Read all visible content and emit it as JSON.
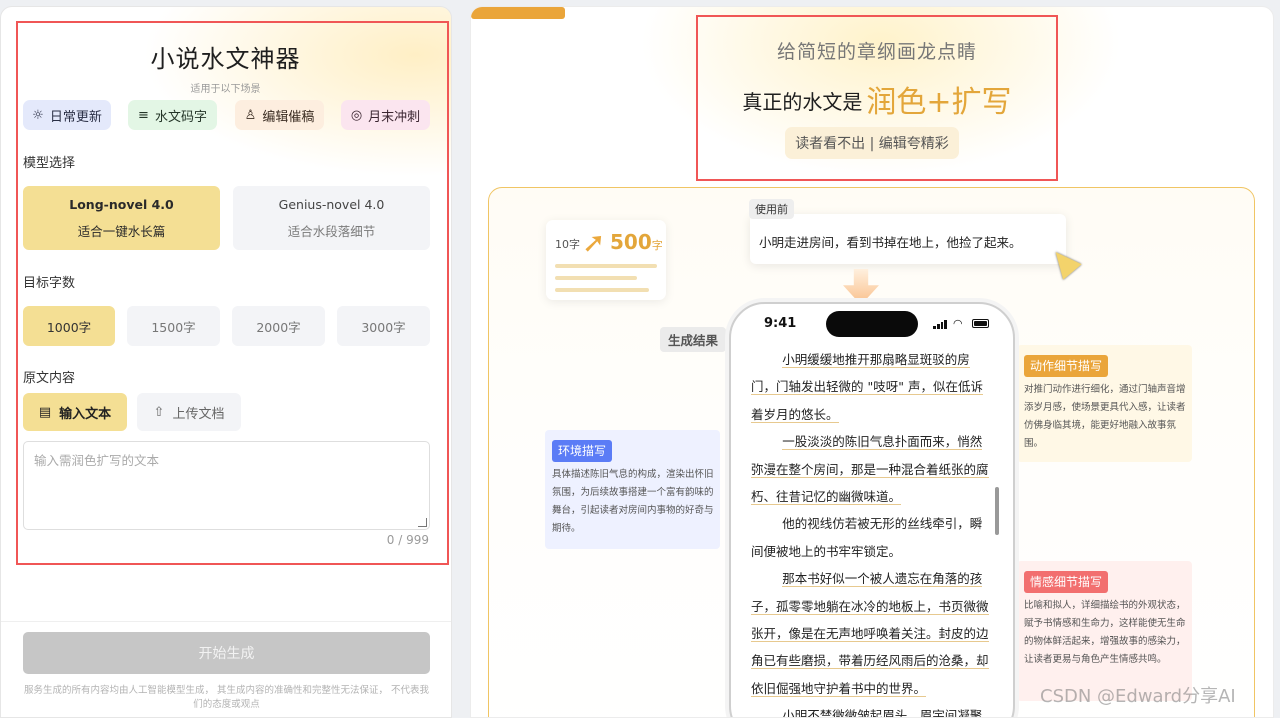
{
  "left": {
    "title": "小说水文神器",
    "subtitle": "适用于以下场景",
    "scenes": [
      {
        "icon": "☼",
        "label": "日常更新"
      },
      {
        "icon": "≡",
        "label": "水文码字"
      },
      {
        "icon": "♙",
        "label": "编辑催稿"
      },
      {
        "icon": "◎",
        "label": "月末冲刺"
      }
    ],
    "model_label": "模型选择",
    "models": [
      {
        "name": "Long-novel 4.0",
        "desc": "适合一键水长篇",
        "selected": true
      },
      {
        "name": "Genius-novel 4.0",
        "desc": "适合水段落细节",
        "selected": false
      }
    ],
    "count_label": "目标字数",
    "counts": [
      "1000字",
      "1500字",
      "2000字",
      "3000字"
    ],
    "selected_count": "1000字",
    "source_label": "原文内容",
    "source_modes": [
      {
        "icon": "▤",
        "label": "输入文本"
      },
      {
        "icon": "⇧",
        "label": "上传文档"
      }
    ],
    "textarea_placeholder": "输入需润色扩写的文本",
    "char_counter": "0 / 999",
    "generate_label": "开始生成",
    "disclaimer": "服务生成的所有内容均由人工智能模型生成， 其生成内容的准确性和完整性无法保证， 不代表我们的态度或观点"
  },
  "right": {
    "hero": {
      "line1": "给简短的章纲画龙点睛",
      "line2_prefix": "真正的水文是",
      "line2_accent": "润色+扩写",
      "pill": "读者看不出 | 编辑夸精彩"
    },
    "stat": {
      "from": "10字",
      "to_num": "500",
      "to_unit": "字"
    },
    "before": {
      "tag": "使用前",
      "text": "小明走进房间，看到书掉在地上，他捡了起来。"
    },
    "result_tag": "生成结果",
    "phone": {
      "time": "9:41",
      "paragraphs": [
        "小明缓缓地推开那扇略显斑驳的房门，门轴发出轻微的 \"吱呀\" 声，似在低诉着岁月的悠长。",
        "一股淡淡的陈旧气息扑面而来，悄然弥漫在整个房间，那是一种混合着纸张的腐朽、往昔记忆的幽微味道。",
        "他的视线仿若被无形的丝线牵引，瞬间便被地上的书牢牢锁定。",
        "那本书好似一个被人遗忘在角落的孩子，孤零零地躺在冰冷的地板上，书页微微张开，像是在无声地呼唤着关注。封皮的边角已有些磨损，带着历经风雨后的沧桑，却依旧倔强地守护着书中的世界。",
        "小明不禁微微皱起眉头，眉宇间凝聚"
      ]
    },
    "annotations": {
      "env": {
        "tag": "环境描写",
        "text": "具体描述陈旧气息的构成，渲染出怀旧氛围，为后续故事搭建一个富有韵味的舞台，引起读者对房间内事物的好奇与期待。"
      },
      "action": {
        "tag": "动作细节描写",
        "text": "对推门动作进行细化，通过门轴声音增添岁月感，使场景更具代入感，让读者仿佛身临其境，能更好地融入故事氛围。"
      },
      "emotion": {
        "tag": "情感细节描写",
        "text": "比喻和拟人，详细描绘书的外观状态，赋予书情感和生命力，这样能使无生命的物体鲜活起来，增强故事的感染力，让读者更易与角色产生情感共鸣。"
      }
    }
  },
  "watermark": "CSDN @Edward分享AI",
  "colors": {
    "accent": "#e3a63a",
    "selected_bg": "#f4df94",
    "frame": "#f05656"
  }
}
